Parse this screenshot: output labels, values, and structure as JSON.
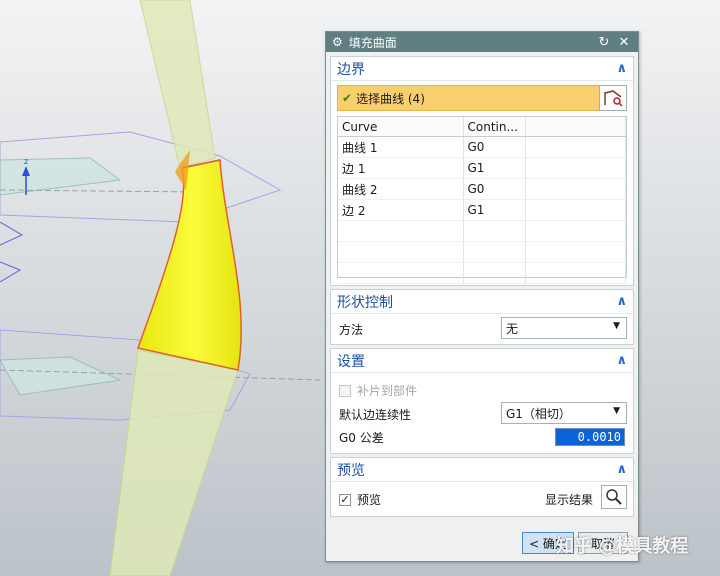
{
  "dialog": {
    "title": "填充曲面",
    "boundary": {
      "header": "边界",
      "select_label": "选择曲线 (4)",
      "columns": [
        "Curve",
        "Contin..."
      ],
      "rows": [
        {
          "curve": "曲线 1",
          "contin": "G0"
        },
        {
          "curve": "边 1",
          "contin": "G1"
        },
        {
          "curve": "曲线 2",
          "contin": "G0"
        },
        {
          "curve": "边 2",
          "contin": "G1"
        }
      ]
    },
    "shape_control": {
      "header": "形状控制",
      "method_label": "方法",
      "method_value": "无"
    },
    "settings": {
      "header": "设置",
      "patch_to_part_label": "补片到部件",
      "default_edge_label": "默认边连续性",
      "default_edge_value": "G1（相切）",
      "g0_tol_label": "G0 公差",
      "g0_tol_value": "0.0010"
    },
    "preview": {
      "header": "预览",
      "preview_label": "预览",
      "show_result_label": "显示结果"
    },
    "buttons": {
      "ok": "< 确定",
      "cancel": "取消"
    }
  },
  "watermark": "知乎 @模具教程",
  "colors": {
    "titlebar": "#5f7f83",
    "select_highlight": "#f9cf6d",
    "surface_yellow": "#f2f21a",
    "surface_edge": "#e0602a",
    "input_selected": "#0a64d8"
  }
}
